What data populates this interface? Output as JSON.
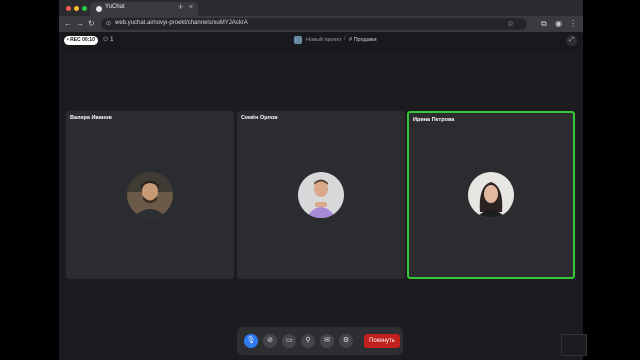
{
  "browser": {
    "tab_title": "YuChat",
    "url": "web.yuchat.ai/novyi-proekt/channels/xuMYJAckrA"
  },
  "call": {
    "rec_label": "• REC 00:10",
    "participants_count": "1",
    "project_name": "Новый проект",
    "separator": "/",
    "channel_name": "# Продажи"
  },
  "tiles": [
    {
      "name": "Валера Иванов",
      "active": false
    },
    {
      "name": "Семён Орлов",
      "active": false
    },
    {
      "name": "Ирина Петрова",
      "active": true
    }
  ],
  "controls": {
    "leave_label": "Покинуть"
  },
  "colors": {
    "active_speaker": "#35c735",
    "mic_button": "#2f7cf2",
    "leave_button": "#c2201d"
  }
}
